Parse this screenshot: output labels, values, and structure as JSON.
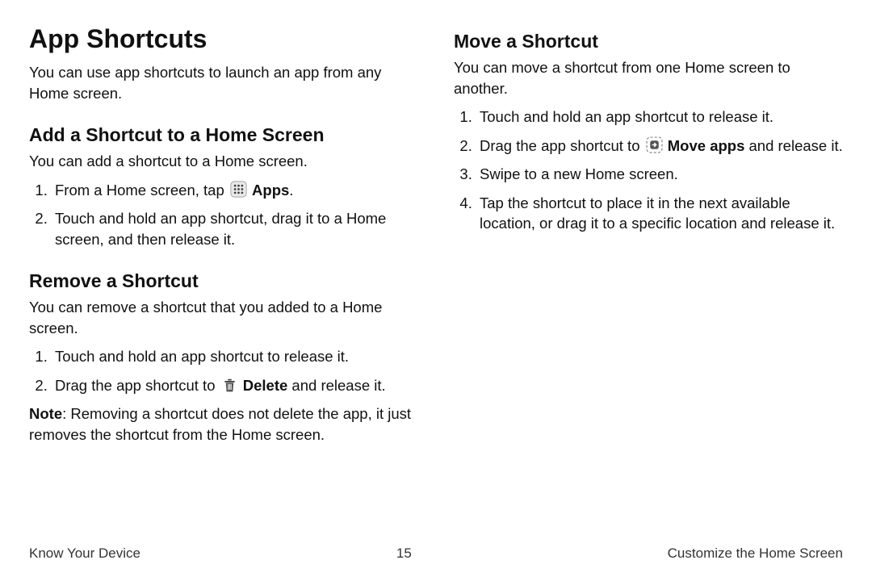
{
  "h1": "App Shortcuts",
  "intro": "You can use app shortcuts to launch an app from any Home screen.",
  "add": {
    "title": "Add a Shortcut to a Home Screen",
    "intro": "You can add a shortcut to a Home screen.",
    "step1_pre": "From a Home screen, tap ",
    "step1_icon_name": "apps-grid-icon",
    "step1_bold": "Apps",
    "step1_post": ".",
    "step2": "Touch and hold an app shortcut, drag it to a Home screen, and then release it."
  },
  "remove": {
    "title": "Remove a Shortcut",
    "intro": "You can remove a shortcut that you added to a Home screen.",
    "step1": "Touch and hold an app shortcut to release it.",
    "step2_pre": "Drag the app shortcut to ",
    "step2_icon_name": "trash-icon",
    "step2_bold": "Delete",
    "step2_post": " and release it.",
    "note_label": "Note",
    "note_body": ": Removing a shortcut does not delete the app, it just removes the shortcut from the Home screen."
  },
  "move": {
    "title": "Move a Shortcut",
    "intro": "You can move a shortcut from one Home screen to another.",
    "step1": "Touch and hold an app shortcut to release it.",
    "step2_pre": "Drag the app shortcut to ",
    "step2_icon_name": "move-apps-icon",
    "step2_bold": "Move apps",
    "step2_post": " and release it.",
    "step3": "Swipe to a new Home screen.",
    "step4": "Tap the shortcut to place it in the next available location, or drag it to a specific location and release it."
  },
  "footer": {
    "left": "Know Your Device",
    "page": "15",
    "right": "Customize the Home Screen"
  }
}
